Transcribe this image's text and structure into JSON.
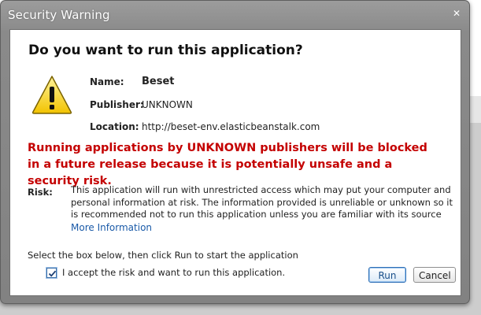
{
  "window": {
    "title": "Security Warning",
    "close_label": "✕"
  },
  "dialog": {
    "heading": "Do you want to run this application?",
    "icon": "warning-triangle-icon",
    "fields": {
      "name_label": "Name:",
      "name_value": "Beset",
      "publisher_label": "Publisher:",
      "publisher_value": "UNKNOWN",
      "location_label": "Location:",
      "location_value": "http://beset-env.elasticbeanstalk.com"
    },
    "blocked_message": "Running applications by UNKNOWN publishers will be blocked in a future release because it is potentially unsafe and a security risk.",
    "risk_label": "Risk:",
    "risk_text": "This application will run with unrestricted access which may put your computer and personal information at risk. The information provided is unreliable or unknown so it is recommended not to run this application unless you are familiar with its source",
    "more_info": "More Information",
    "instruction": "Select the box below, then click Run to start the application",
    "accept_label": "I accept the risk and want to run this application.",
    "accept_checked": true,
    "buttons": {
      "run": "Run",
      "cancel": "Cancel"
    }
  },
  "colors": {
    "warning_text": "#c40000",
    "link": "#1a5aa8",
    "title_bar": "#8c8c8c"
  }
}
